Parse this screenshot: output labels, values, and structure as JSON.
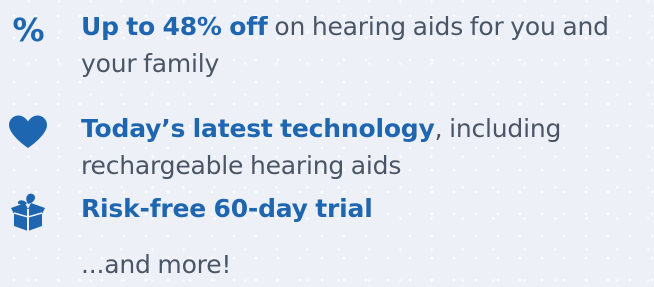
{
  "benefits": [
    {
      "icon": "percent-icon",
      "highlight": "Up to 48% off",
      "rest": " on hearing aids for you and your family"
    },
    {
      "icon": "heart-icon",
      "highlight": "Today’s latest technology",
      "rest": ", including rechargeable hearing aids"
    },
    {
      "icon": "gift-box-icon",
      "highlight": "Risk-free 60-day trial",
      "rest": ""
    }
  ],
  "more_text": "...and more!",
  "colors": {
    "accent": "#1f66b1",
    "text": "#4b5566",
    "background": "#edf1f7"
  }
}
